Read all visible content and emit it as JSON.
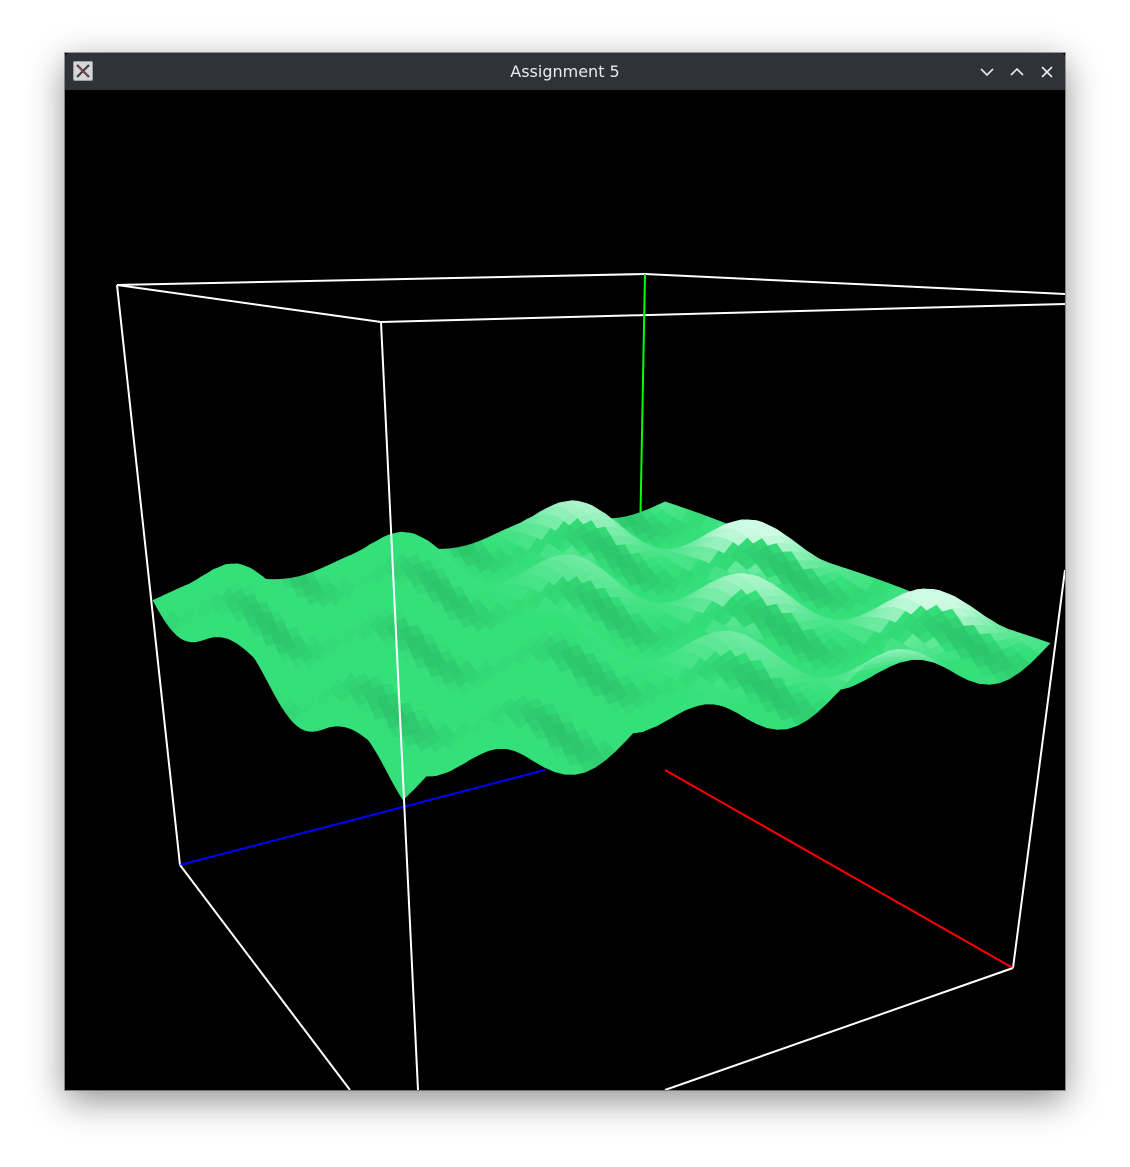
{
  "window": {
    "title": "Assignment 5",
    "app_icon": "x-app-icon",
    "controls": [
      {
        "name": "minimize",
        "icon": "chevron-down-icon"
      },
      {
        "name": "maximize",
        "icon": "chevron-up-icon"
      },
      {
        "name": "close",
        "icon": "close-icon"
      }
    ]
  },
  "scene": {
    "background_color": "#000000",
    "bounding_box_color": "#ffffff",
    "surface_color": "#35e07a",
    "surface_highlight_color": "#e8fff4",
    "axes": [
      {
        "axis": "x",
        "color": "#ff0000"
      },
      {
        "axis": "y",
        "color": "#00ff00"
      },
      {
        "axis": "z",
        "color": "#0000ff"
      }
    ]
  }
}
